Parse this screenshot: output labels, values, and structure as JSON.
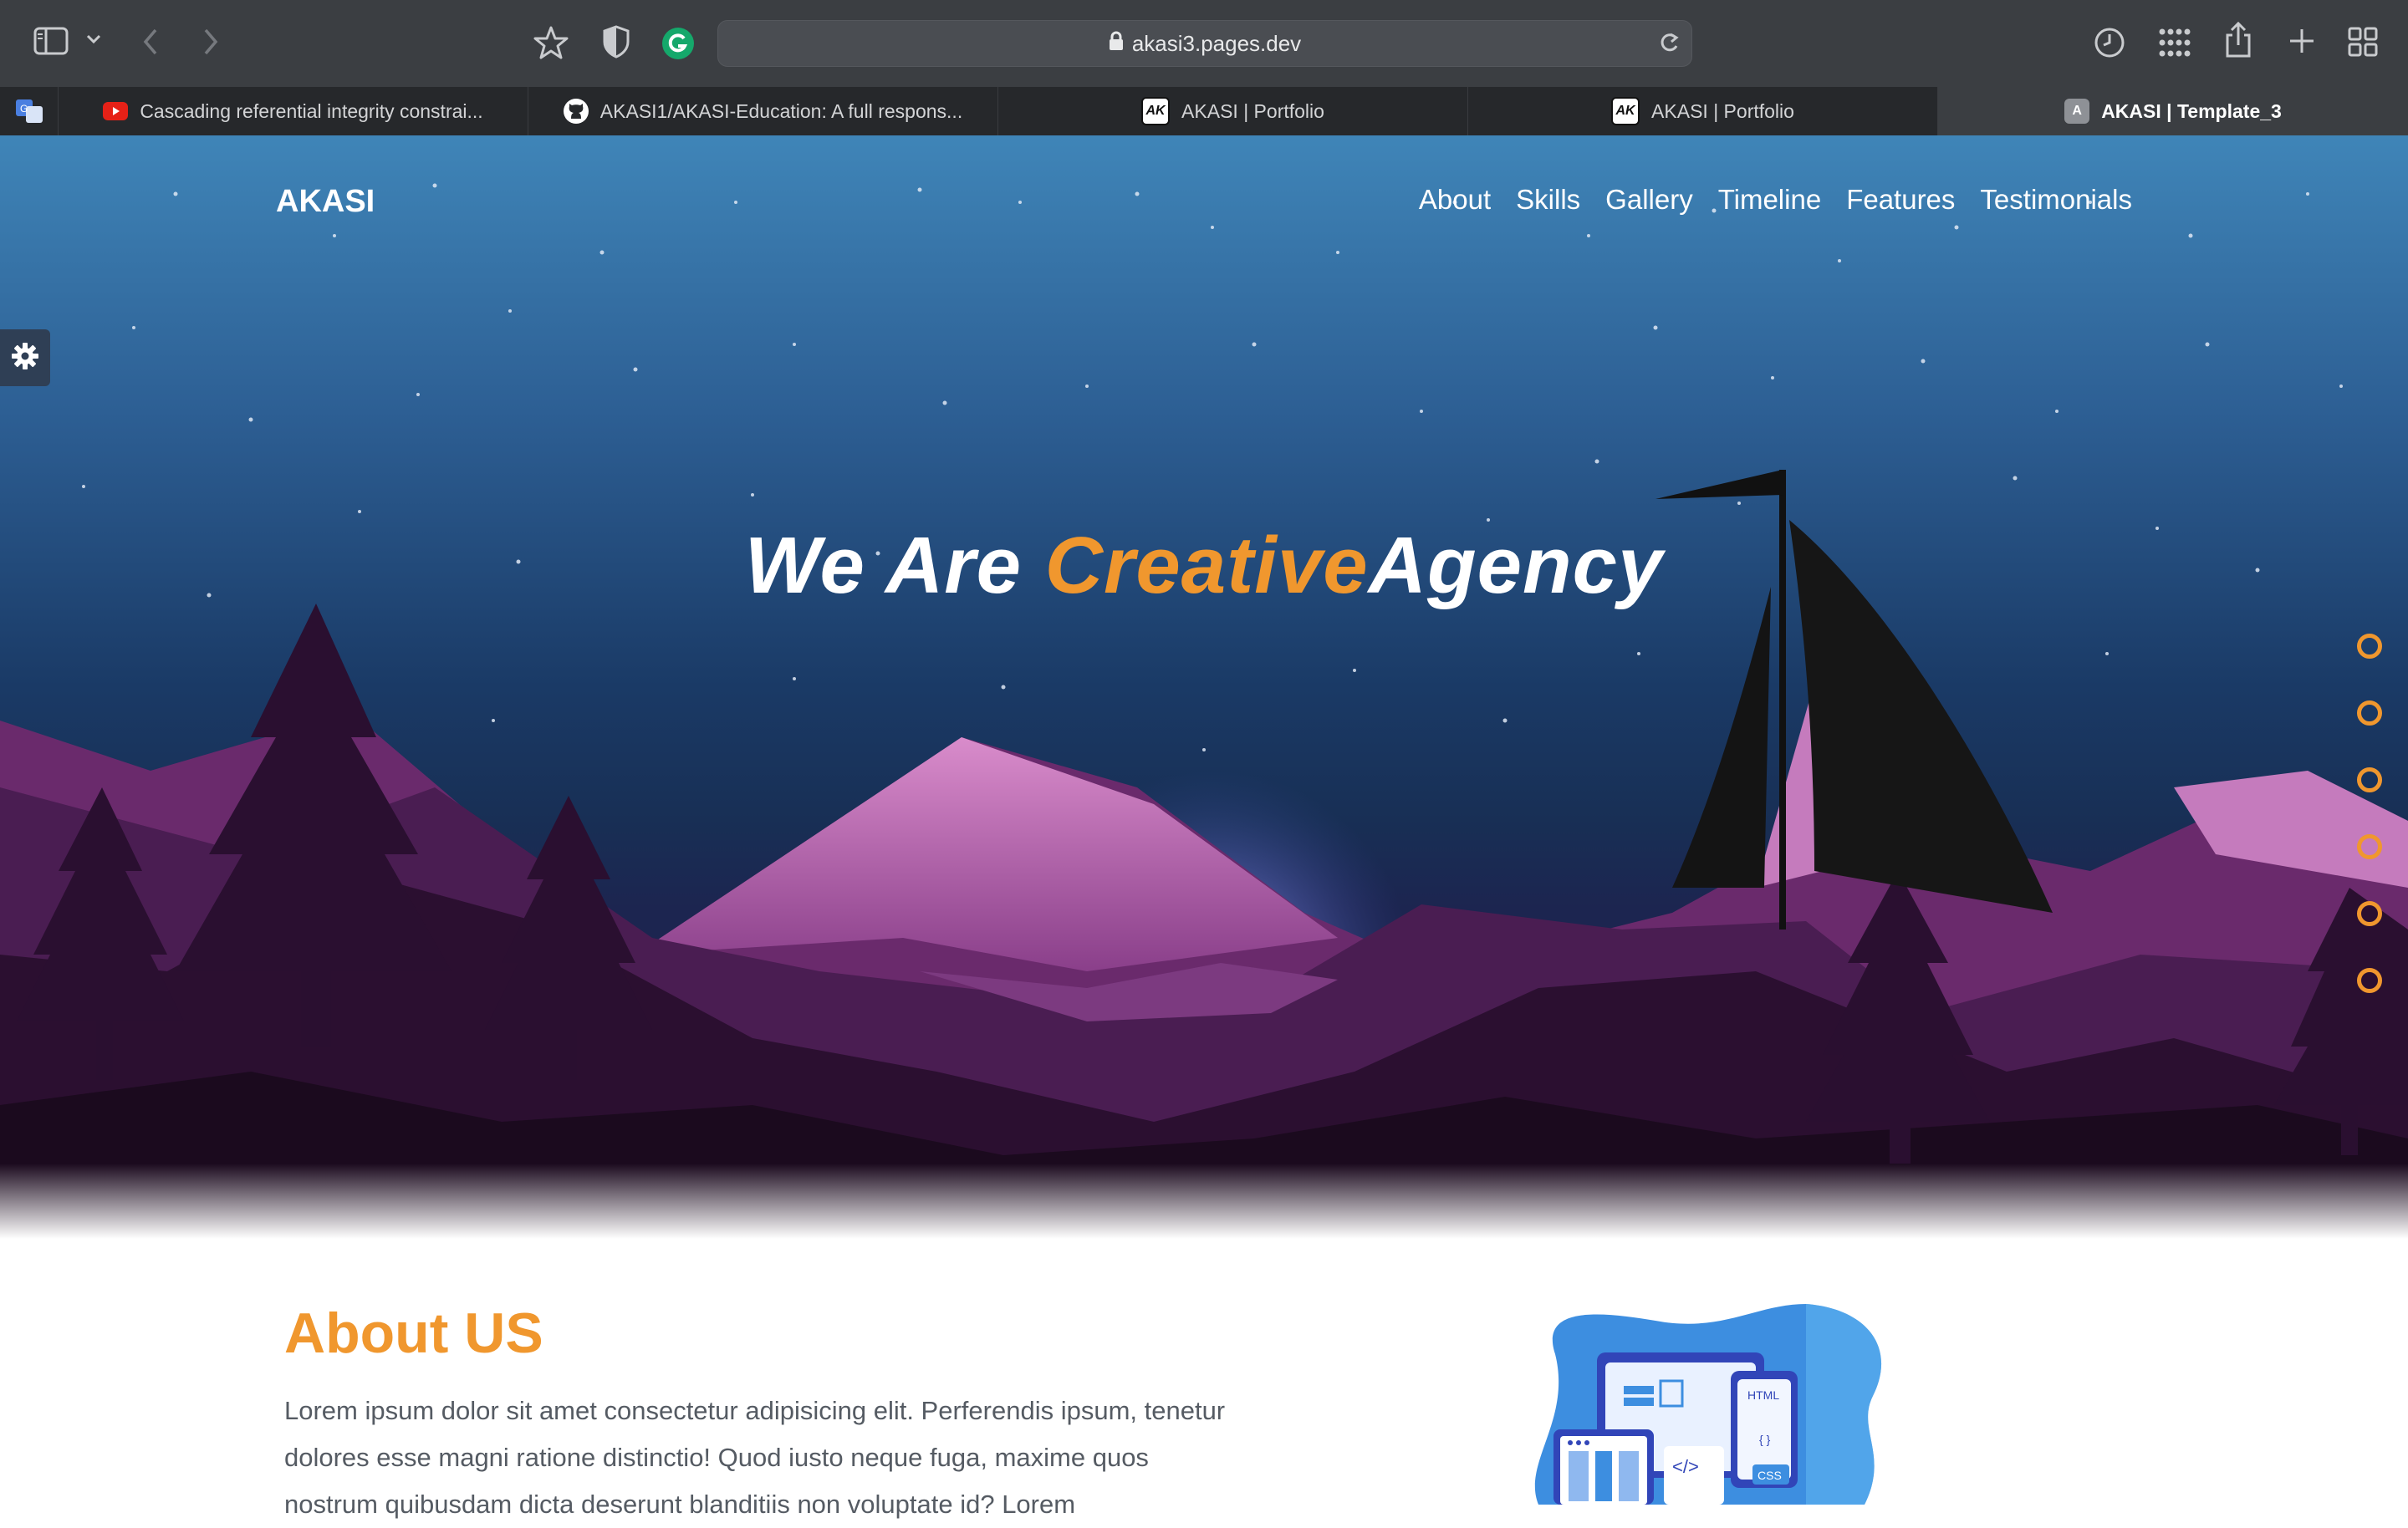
{
  "browser": {
    "url": "akasi3.pages.dev",
    "tabs": [
      {
        "label": "Cascading referential integrity constrai...",
        "icon": "youtube-icon"
      },
      {
        "label": "AKASI1/AKASI-Education: A full respons...",
        "icon": "github-icon"
      },
      {
        "label": "AKASI | Portfolio",
        "icon": "ak-logo-icon"
      },
      {
        "label": "AKASI | Portfolio",
        "icon": "ak-logo-icon"
      },
      {
        "label": "AKASI | Template_3",
        "icon": "a-letter-icon",
        "active": true
      }
    ],
    "favicon_text": {
      "ak": "AK",
      "a": "A"
    }
  },
  "site": {
    "brand": "AKASI",
    "nav": [
      "About",
      "Skills",
      "Gallery",
      "Timeline",
      "Features",
      "Testimonials"
    ],
    "hero": {
      "headline_prefix": "We Are ",
      "headline_accent": "Creative",
      "headline_suffix": "Agency"
    },
    "section_dots_count": 6,
    "about": {
      "title": "About US",
      "text": "Lorem ipsum dolor sit amet consectetur adipisicing elit. Perferendis ipsum, tenetur dolores esse magni ratione distinctio! Quod iusto neque fuga, maxime quos nostrum quibusdam dicta deserunt blanditiis non voluptate id? Lorem",
      "illustration_labels": [
        "HTML",
        "CSS",
        "</>",
        "{ }"
      ]
    }
  },
  "colors": {
    "accent": "#f0972e",
    "chrome": "#3b3e42",
    "tabstrip": "#26282b",
    "sky_top": "#3f85b8",
    "mountain": "#4a1d52"
  }
}
